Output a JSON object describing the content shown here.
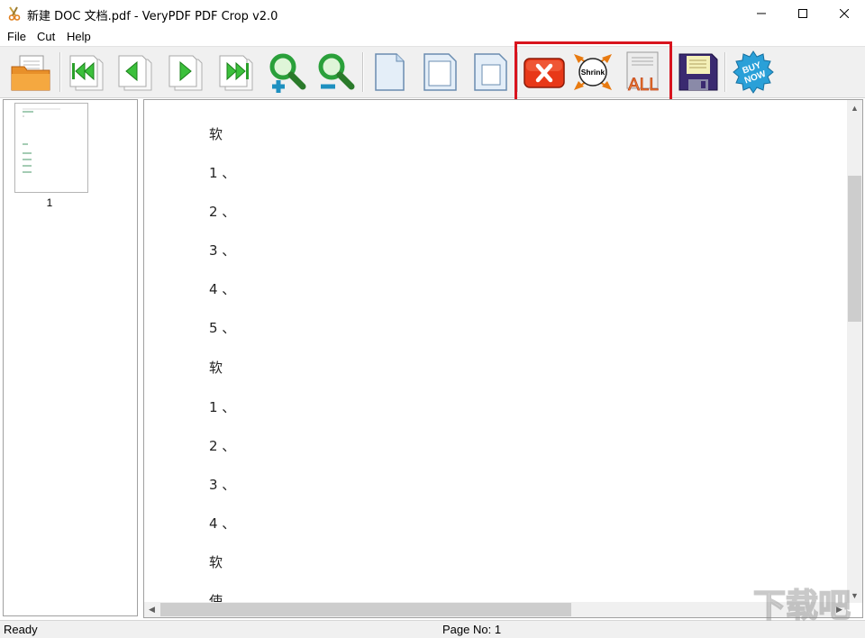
{
  "window": {
    "title": "新建 DOC 文档.pdf - VeryPDF PDF Crop v2.0"
  },
  "menu": {
    "items": [
      "File",
      "Cut",
      "Help"
    ]
  },
  "toolbar": {
    "shrink_label": "Shrink",
    "all_label": "ALL",
    "buy_label_1": "BUY",
    "buy_label_2": "NOW",
    "highlight_color": "#d8141e"
  },
  "thumbnails": {
    "page_label": "1"
  },
  "document": {
    "lines": [
      "软",
      "1 、",
      "2 、",
      "3 、",
      "4 、",
      "5 、",
      "软",
      "1 、",
      "2 、",
      "3 、",
      "4 、",
      "软",
      "使"
    ]
  },
  "status": {
    "ready": "Ready",
    "page": "Page No: 1"
  },
  "watermark": {
    "text": "下载吧"
  }
}
